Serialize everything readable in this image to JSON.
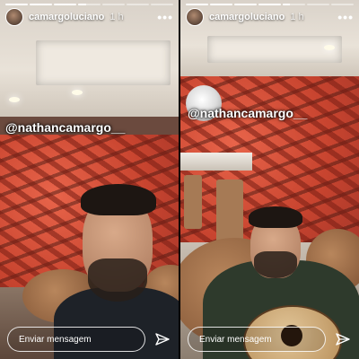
{
  "stories": [
    {
      "username": "camargoluciano",
      "time": "1 h",
      "mention": "@nathancamargo__",
      "reply_placeholder": "Enviar mensagem",
      "progress": [
        1.0,
        1.0,
        1.0,
        0.35,
        0.0,
        0.0,
        0.0
      ]
    },
    {
      "username": "camargoluciano",
      "time": "1 h",
      "mention": "@nathancamargo__",
      "reply_placeholder": "Enviar mensagem",
      "progress": [
        1.0,
        1.0,
        1.0,
        1.0,
        0.3,
        0.0,
        0.0
      ]
    }
  ],
  "icons": {
    "more": "more-options-icon",
    "send": "send-icon"
  },
  "colors": {
    "wallpaper": "#c8442f",
    "text": "#ffffff"
  }
}
